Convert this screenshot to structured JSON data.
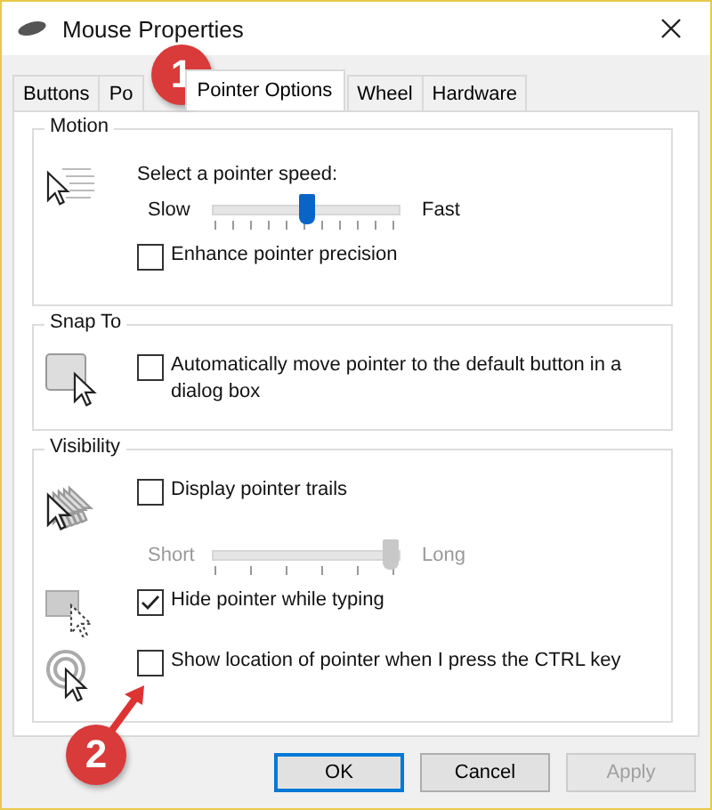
{
  "window": {
    "title": "Mouse Properties"
  },
  "tabs": [
    {
      "label": "Buttons",
      "selected": false
    },
    {
      "label": "Po",
      "selected": false
    },
    {
      "label": "Pointer Options",
      "selected": true
    },
    {
      "label": "Wheel",
      "selected": false
    },
    {
      "label": "Hardware",
      "selected": false
    }
  ],
  "groups": [
    {
      "title": "Motion",
      "rows": [
        {
          "kind": "prompt",
          "label": "Select a pointer speed:"
        },
        {
          "kind": "slider",
          "min_label": "Slow",
          "max_label": "Fast",
          "level": 0.5,
          "disabled": false
        },
        {
          "kind": "checkbox",
          "label": "Enhance pointer precision",
          "checked": false
        }
      ]
    },
    {
      "title": "Snap To",
      "rows": [
        {
          "kind": "checkbox",
          "label": "Automatically move pointer to the default button in a dialog box",
          "checked": false
        }
      ]
    },
    {
      "title": "Visibility",
      "rows": [
        {
          "kind": "checkbox",
          "label": "Display pointer trails",
          "checked": false
        },
        {
          "kind": "slider",
          "min_label": "Short",
          "max_label": "Long",
          "level": 1,
          "disabled": true
        },
        {
          "kind": "checkbox",
          "label": "Hide pointer while typing",
          "checked": true
        },
        {
          "kind": "checkbox",
          "label": "Show location of pointer when I press the CTRL key",
          "checked": false
        }
      ]
    }
  ],
  "buttons": [
    {
      "label": "OK",
      "default": true,
      "disabled": false
    },
    {
      "label": "Cancel",
      "default": false,
      "disabled": false
    },
    {
      "label": "Apply",
      "default": false,
      "disabled": true
    }
  ],
  "callouts": [
    {
      "label": "1"
    },
    {
      "label": "2"
    }
  ]
}
